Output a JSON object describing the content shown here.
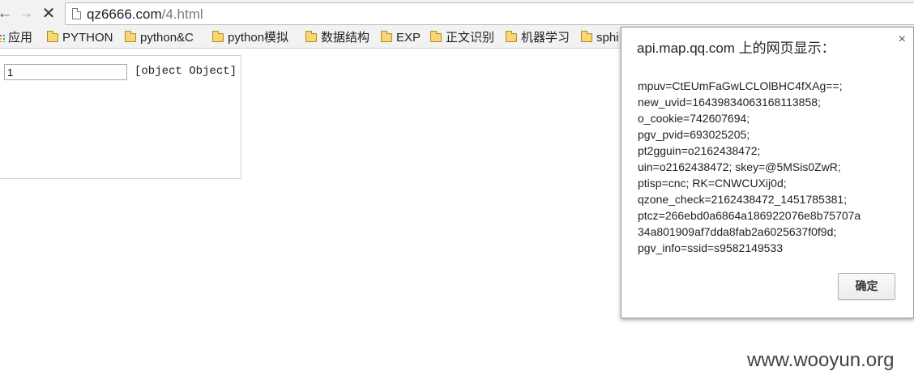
{
  "toolbar": {
    "back_icon": "back-arrow-icon",
    "forward_icon": "forward-arrow-icon",
    "stop_icon": "stop-icon",
    "url_domain": "qz6666.com",
    "url_path": "/4.html"
  },
  "bookmarks": {
    "apps_label": "应用",
    "items": [
      "PYTHON",
      "python&C",
      "python模拟",
      "数据结构",
      "EXP",
      "正文识别",
      "机器学习",
      "sphi"
    ]
  },
  "page": {
    "input_value": "1",
    "output_text": "[object Object]"
  },
  "dialog": {
    "title": "api.map.qq.com 上的网页显示：",
    "close_symbol": "×",
    "message_lines": [
      "mpuv=CtEUmFaGwLCLOlBHC4fXAg==;",
      "new_uvid=16439834063168113858;",
      "o_cookie=742607694;",
      "pgv_pvid=693025205;",
      "pt2gguin=o2162438472;",
      "uin=o2162438472; skey=@5MSis0ZwR;",
      "ptisp=cnc; RK=CNWCUXij0d;",
      "qzone_check=2162438472_1451785381;",
      "ptcz=266ebd0a6864a186922076e8b75707a",
      "34a801909af7dda8fab2a6025637f0f9d;",
      "pgv_info=ssid=s9582149533"
    ],
    "ok_label": "确定"
  },
  "watermark": "www.wooyun.org"
}
